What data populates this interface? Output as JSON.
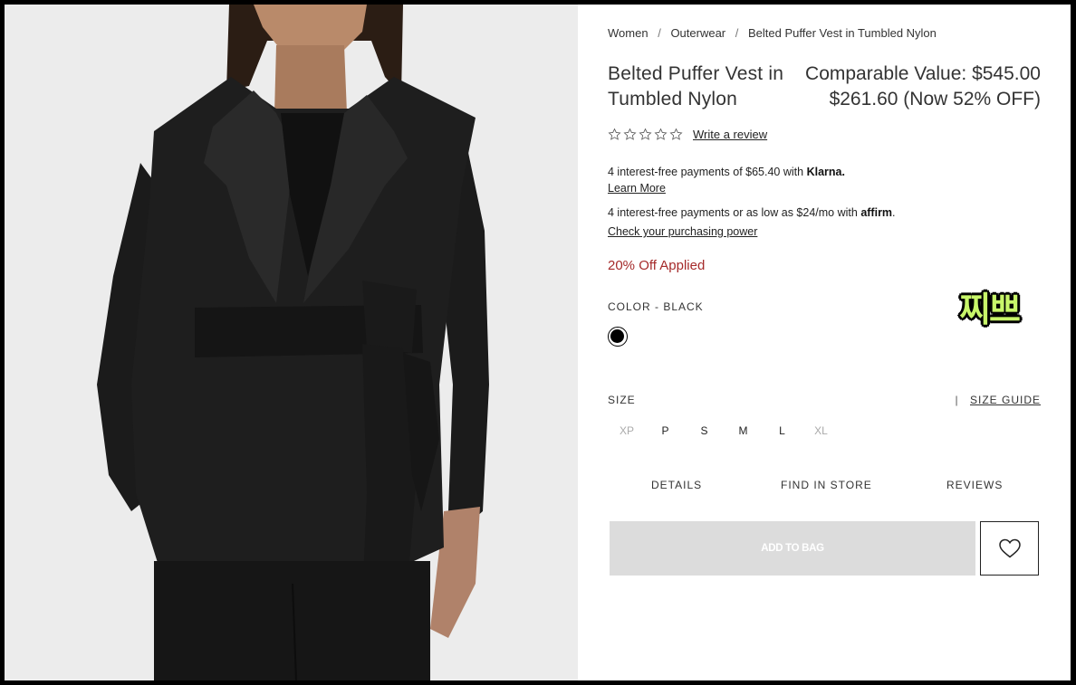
{
  "product_image": {
    "alt": "Belted Puffer Vest in Tumbled Nylon, black, worn by model"
  },
  "breadcrumb": [
    "Women",
    "Outerwear",
    "Belted Puffer Vest in Tumbled Nylon"
  ],
  "product": {
    "title": "Belted Puffer Vest in Tumbled Nylon",
    "comparable_value": "Comparable Value: $545.00",
    "sale_price": "$261.60 (Now 52% OFF)"
  },
  "rating": {
    "stars": 5,
    "filled": 0,
    "write_review": "Write a review"
  },
  "payments": {
    "klarna_text": "4 interest-free payments of $65.40 with",
    "klarna_brand": "Klarna.",
    "klarna_link": "Learn More",
    "affirm_text": "4 interest-free payments or as low as $24/mo with",
    "affirm_brand": "affirm",
    "affirm_link": "Check your purchasing power"
  },
  "promo": "20% Off Applied",
  "color": {
    "label": "COLOR -  BLACK",
    "swatch": "#000000"
  },
  "sticker": "찌쁘",
  "size": {
    "label": "SIZE",
    "guide": "SIZE GUIDE",
    "options": [
      {
        "label": "XP",
        "available": false
      },
      {
        "label": "P",
        "available": true
      },
      {
        "label": "S",
        "available": true
      },
      {
        "label": "M",
        "available": true
      },
      {
        "label": "L",
        "available": true
      },
      {
        "label": "XL",
        "available": false
      }
    ]
  },
  "tabs": [
    "DETAILS",
    "FIND IN STORE",
    "REVIEWS"
  ],
  "actions": {
    "add_to_bag": "ADD TO BAG",
    "wishlist_icon": "heart-icon"
  },
  "colors": {
    "promo": "#a52a2a",
    "button_disabled": "#dcdcdc",
    "sticker": "#c8f66a"
  }
}
